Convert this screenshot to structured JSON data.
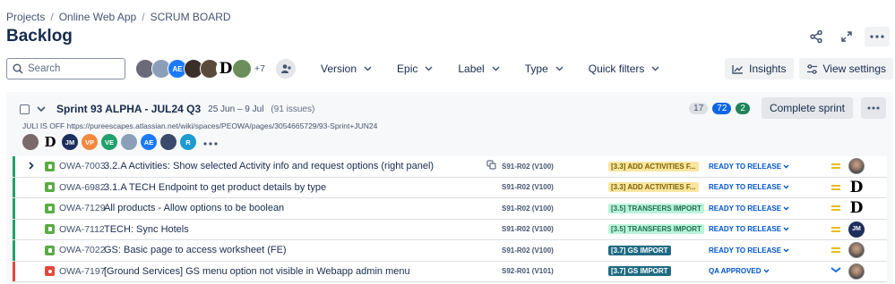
{
  "breadcrumb": [
    "Projects",
    "Online Web App",
    "SCRUM BOARD"
  ],
  "page_title": "Backlog",
  "header_icons": [
    "share-icon",
    "expand-icon",
    "more-icon"
  ],
  "search": {
    "placeholder": "Search"
  },
  "toolbar_avatars": [
    {
      "initials": "",
      "color": "#6a6a7a"
    },
    {
      "initials": "",
      "color": "#8ba0b8"
    },
    {
      "initials": "AE",
      "color": "#1d7afc"
    },
    {
      "initials": "",
      "color": "#3b2f2a"
    },
    {
      "initials": "",
      "color": "#5a4a3a"
    },
    {
      "initials": "D",
      "color": "#000000"
    },
    {
      "initials": "",
      "color": "#6b8e5a"
    }
  ],
  "toolbar_avatars_more": "+7",
  "filters": [
    {
      "label": "Version"
    },
    {
      "label": "Epic"
    },
    {
      "label": "Label"
    },
    {
      "label": "Type"
    },
    {
      "label": "Quick filters"
    }
  ],
  "toolbar_right": {
    "insights": "Insights",
    "view_settings": "View settings"
  },
  "sprint": {
    "name": "Sprint 93 ALPHA - JUL24 Q3",
    "dates": "25 Jun – 9 Jul",
    "issue_count": "(91 issues)",
    "description": "JULI IS OFF https://pureescapes.atlassian.net/wiki/spaces/PEOWA/pages/3054665729/93-Sprint+JUN24",
    "counts": {
      "todo": "17",
      "in_progress": "72",
      "done": "2"
    },
    "complete_label": "Complete sprint",
    "avatars": [
      {
        "initials": "",
        "color": "#7a6a6a"
      },
      {
        "initials": "D",
        "color": "#000000"
      },
      {
        "initials": "JM",
        "color": "#1d2f5c"
      },
      {
        "initials": "VP",
        "color": "#f38a3f"
      },
      {
        "initials": "VE",
        "color": "#22a06b"
      },
      {
        "initials": "",
        "color": "#8ba0b8"
      },
      {
        "initials": "AE",
        "color": "#1d7afc"
      },
      {
        "initials": "",
        "color": "#3b4a6a"
      },
      {
        "initials": "R",
        "color": "#1d9bd1"
      }
    ]
  },
  "issues": [
    {
      "type": "story",
      "key": "OWA-7003",
      "summary": "3.2.A Activities: Show selected Activity info and request options (right panel)",
      "fix_version": "S91-R02 (V100)",
      "epic": "[3.3] ADD ACTIVITIES F...",
      "epic_color": "yellow",
      "status": "READY TO RELEASE",
      "priority": "medium",
      "assignee": "photo",
      "has_children": true
    },
    {
      "type": "story",
      "key": "OWA-6982",
      "summary": "3.1.A TECH Endpoint to get product details by type",
      "fix_version": "S91-R02 (V100)",
      "epic": "[3.3] ADD ACTIVITIES F...",
      "epic_color": "yellow",
      "status": "READY TO RELEASE",
      "priority": "medium",
      "assignee": "D",
      "has_children": false
    },
    {
      "type": "story",
      "key": "OWA-7129",
      "summary": "All products - Allow options to be boolean",
      "fix_version": "S91-R02 (V100)",
      "epic": "[3.5] TRANSFERS IMPORT",
      "epic_color": "lightgreen",
      "status": "READY TO RELEASE",
      "priority": "medium",
      "assignee": "D",
      "has_children": false
    },
    {
      "type": "story",
      "key": "OWA-7112",
      "summary": "TECH: Sync Hotels",
      "fix_version": "S91-R02 (V100)",
      "epic": "[3.5] TRANSFERS IMPORT",
      "epic_color": "lightgreen",
      "status": "READY TO RELEASE",
      "priority": "medium",
      "assignee": "JM",
      "has_children": false
    },
    {
      "type": "story",
      "key": "OWA-7022",
      "summary": "GS: Basic page to access worksheet (FE)",
      "fix_version": "S91-R02 (V100)",
      "epic": "[3.7] GS IMPORT",
      "epic_color": "teal",
      "status": "READY TO RELEASE",
      "priority": "medium",
      "assignee": "photo",
      "has_children": false
    },
    {
      "type": "bug",
      "key": "OWA-7197",
      "summary": "[Ground Services] GS menu option not visible in Webapp admin menu",
      "fix_version": "S92-R01 (V101)",
      "epic": "[3.7] GS IMPORT",
      "epic_color": "teal",
      "status": "QA APPROVED",
      "priority": "low",
      "assignee": "photo",
      "has_children": false
    }
  ]
}
